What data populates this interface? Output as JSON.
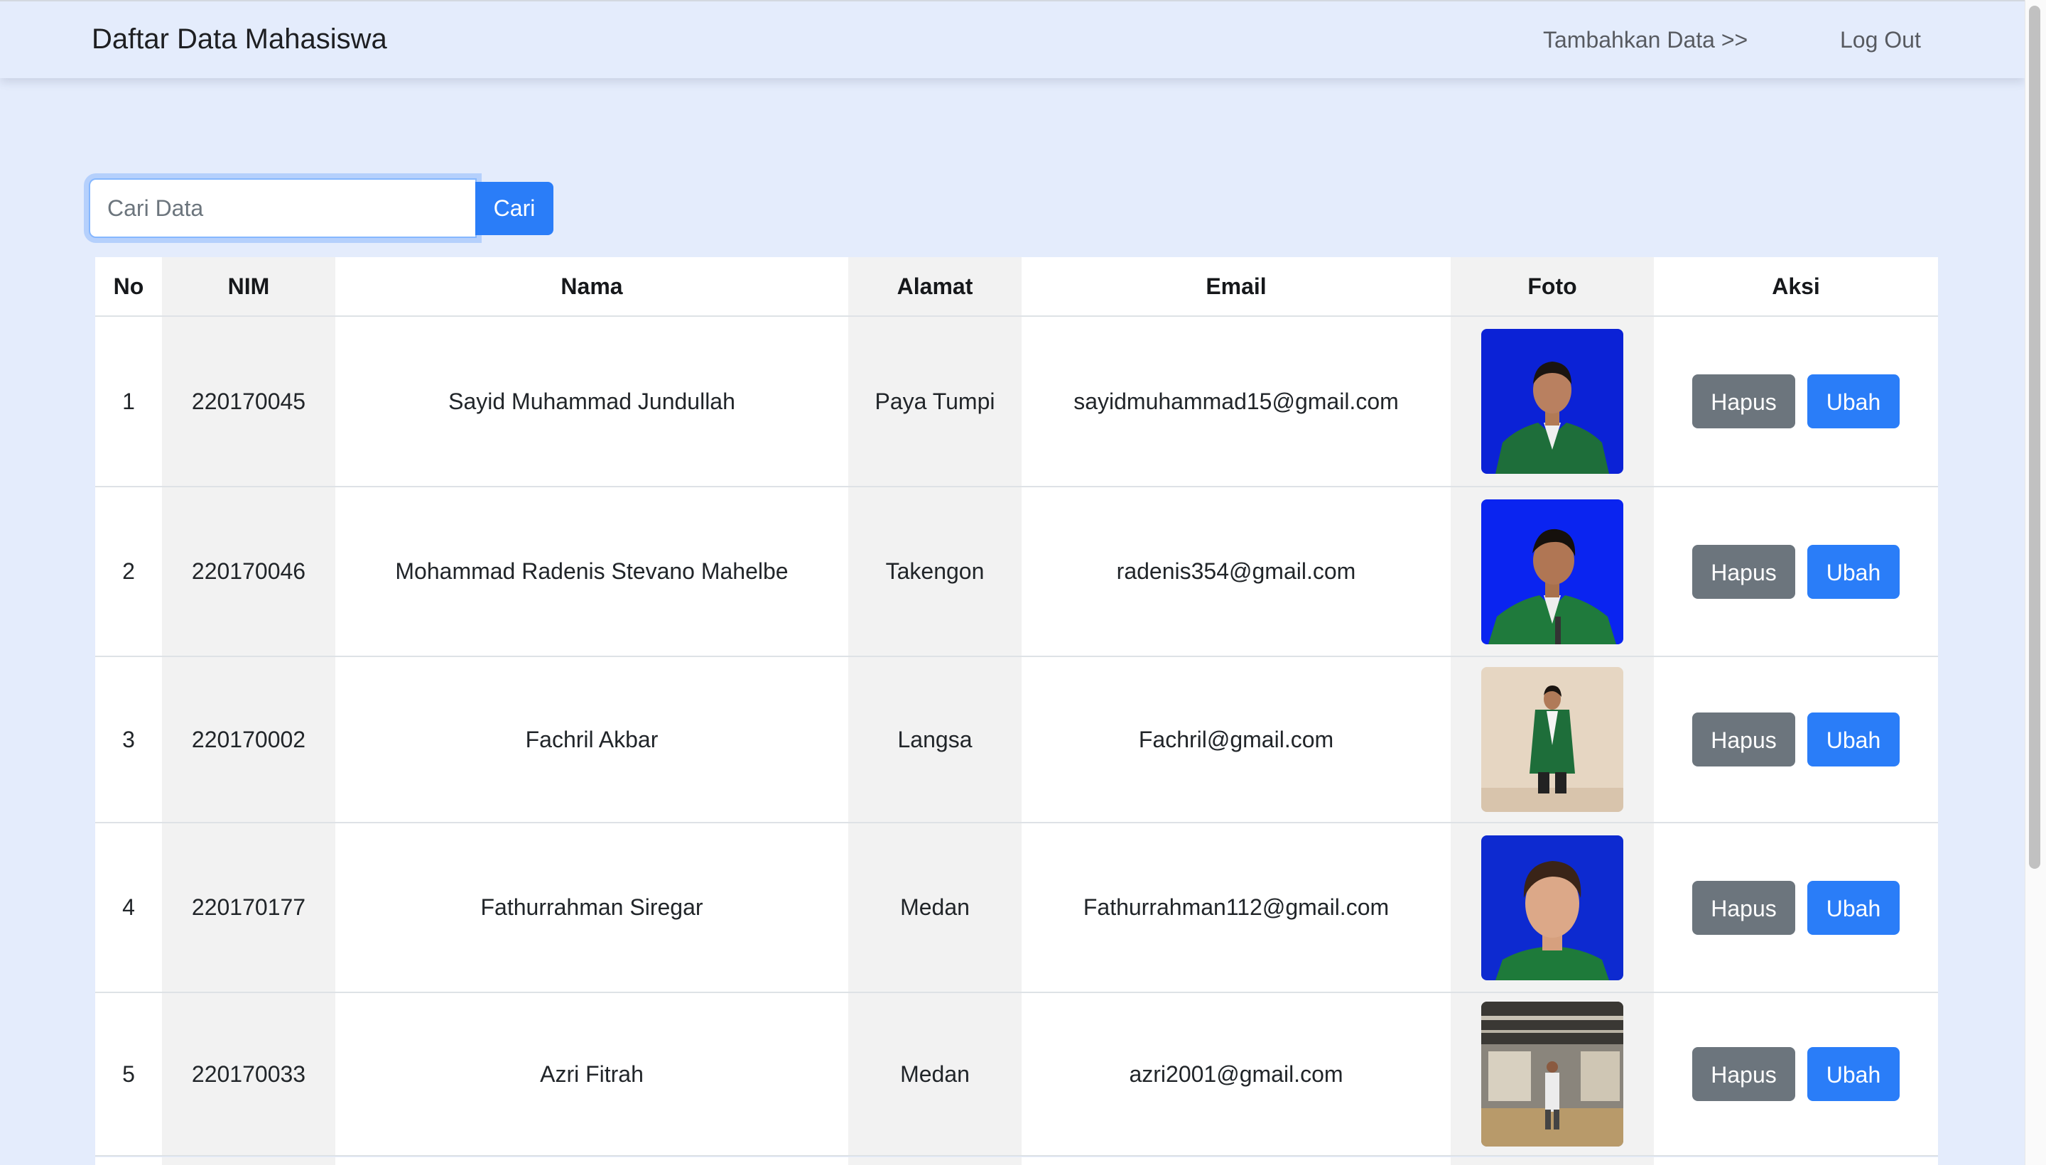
{
  "navbar": {
    "brand": "Daftar Data Mahasiswa",
    "add_link": "Tambahkan Data >>",
    "logout_link": "Log Out"
  },
  "search": {
    "placeholder": "Cari Data",
    "value": "",
    "button": "Cari"
  },
  "table": {
    "headers": [
      "No",
      "NIM",
      "Nama",
      "Alamat",
      "Email",
      "Foto",
      "Aksi"
    ],
    "rows": [
      {
        "no": "1",
        "nim": "220170045",
        "nama": "Sayid Muhammad Jundullah",
        "alamat": "Paya Tumpi",
        "email": "sayidmuhammad15@gmail.com"
      },
      {
        "no": "2",
        "nim": "220170046",
        "nama": "Mohammad Radenis Stevano Mahelbe",
        "alamat": "Takengon",
        "email": "radenis354@gmail.com"
      },
      {
        "no": "3",
        "nim": "220170002",
        "nama": "Fachril Akbar",
        "alamat": "Langsa",
        "email": "Fachril@gmail.com"
      },
      {
        "no": "4",
        "nim": "220170177",
        "nama": "Fathurrahman Siregar",
        "alamat": "Medan",
        "email": "Fathurrahman112@gmail.com"
      },
      {
        "no": "5",
        "nim": "220170033",
        "nama": "Azri Fitrah",
        "alamat": "Medan",
        "email": "azri2001@gmail.com"
      }
    ],
    "action_delete": "Hapus",
    "action_edit": "Ubah"
  },
  "colors": {
    "page_background": "#e4ecfc",
    "primary": "#2a7df8",
    "secondary": "#6c757d",
    "column_shade": "#f2f2f2"
  }
}
